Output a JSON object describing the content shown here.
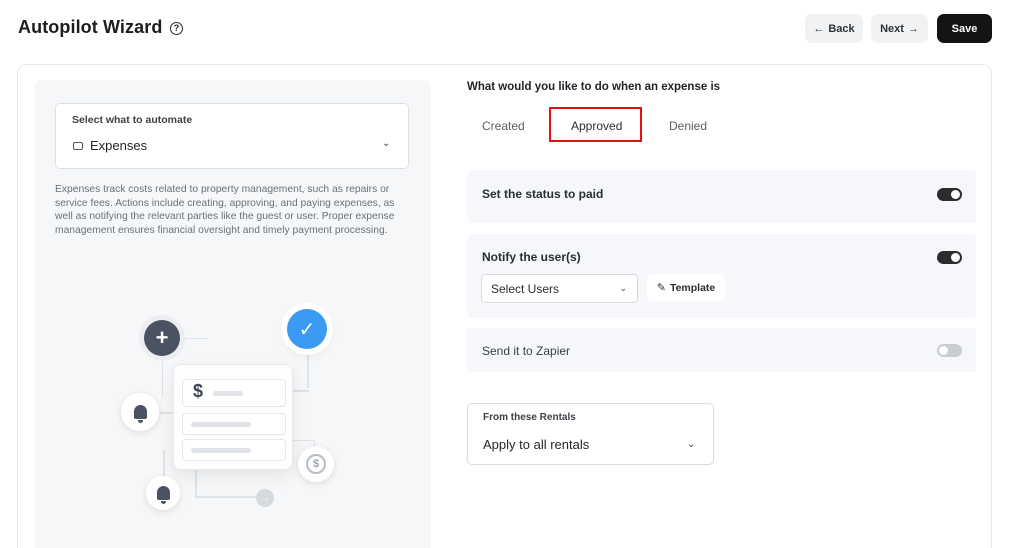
{
  "header": {
    "title": "Autopilot Wizard",
    "help_glyph": "?",
    "back_label": "Back",
    "next_label": "Next",
    "save_label": "Save"
  },
  "left": {
    "automate_label": "Select what to automate",
    "automate_value": "Expenses",
    "description": "Expenses track costs related to property management, such as repairs or service fees. Actions include creating, approving, and paying expenses, as well as notifying the relevant parties like the guest or user. Proper expense management ensures financial oversight and timely payment processing."
  },
  "right": {
    "question": "What would you like to do when an expense is",
    "tabs": [
      {
        "label": "Created",
        "selected": false
      },
      {
        "label": "Approved",
        "selected": true
      },
      {
        "label": "Denied",
        "selected": false
      }
    ],
    "actions": [
      {
        "label": "Set the status to paid",
        "enabled": true
      },
      {
        "label": "Notify the user(s)",
        "enabled": true
      },
      {
        "label": "Send it to Zapier",
        "enabled": false
      }
    ],
    "users_select": "Select Users",
    "template_label": "Template",
    "rentals_label": "From these Rentals",
    "rentals_value": "Apply to all rentals"
  },
  "icons": {
    "dollar": "$",
    "coin": "$",
    "plus": "+",
    "check": "✓",
    "arrow": "→"
  },
  "colors": {
    "accent": "#3b9af1",
    "highlight": "#e01111",
    "save": "#141414"
  }
}
